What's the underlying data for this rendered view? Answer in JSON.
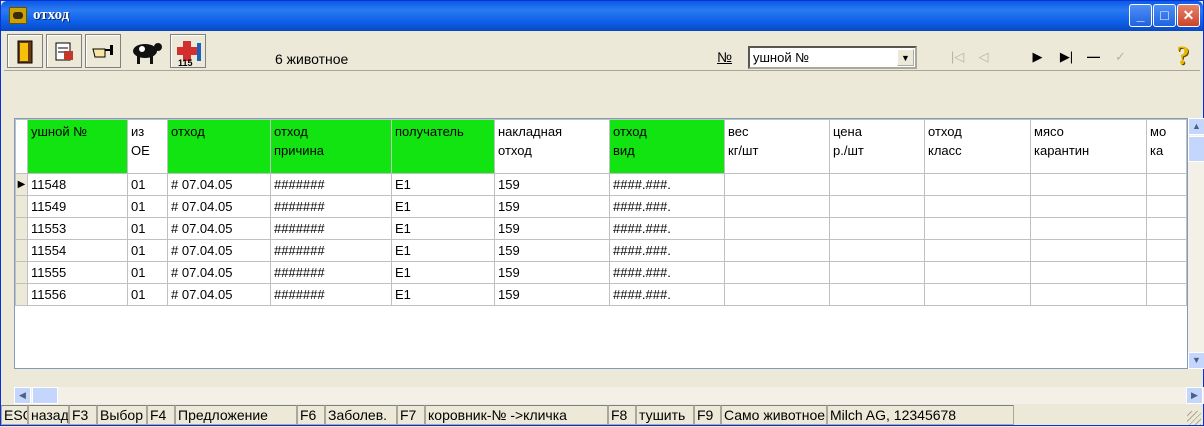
{
  "window": {
    "title": "отход"
  },
  "toolbar": {
    "record_label": "6  животное",
    "no_label": "№",
    "combo_value": "ушной №",
    "nav": {
      "first": "|◁",
      "prev": "◁",
      "next": "▶",
      "last": "▶|",
      "delete": "—",
      "post": "✓"
    },
    "help": "?"
  },
  "grid": {
    "columns": [
      {
        "l1": "ушной №",
        "l2": "",
        "green": true
      },
      {
        "l1": "из",
        "l2": "ОЕ",
        "green": false
      },
      {
        "l1": "отход",
        "l2": "",
        "green": true
      },
      {
        "l1": "отход",
        "l2": "причина",
        "green": true
      },
      {
        "l1": "получатель",
        "l2": "",
        "green": true
      },
      {
        "l1": "накладная",
        "l2": "отход",
        "green": false
      },
      {
        "l1": "отход",
        "l2": "вид",
        "green": true
      },
      {
        "l1": "вес",
        "l2": "кг/шт",
        "green": false
      },
      {
        "l1": "цена",
        "l2": "р./шт",
        "green": false
      },
      {
        "l1": "отход",
        "l2": "класс",
        "green": false
      },
      {
        "l1": "мясо",
        "l2": "карантин",
        "green": false
      },
      {
        "l1": "мо",
        "l2": "ка",
        "green": false
      }
    ],
    "rows": [
      [
        "11548",
        "01",
        "# 07.04.05",
        "#######",
        "E1",
        "159",
        "####.###.",
        "",
        "",
        "",
        "",
        ""
      ],
      [
        "11549",
        "01",
        "# 07.04.05",
        "#######",
        "E1",
        "159",
        "####.###.",
        "",
        "",
        "",
        "",
        ""
      ],
      [
        "11553",
        "01",
        "# 07.04.05",
        "#######",
        "E1",
        "159",
        "####.###.",
        "",
        "",
        "",
        "",
        ""
      ],
      [
        "11554",
        "01",
        "# 07.04.05",
        "#######",
        "E1",
        "159",
        "####.###.",
        "",
        "",
        "",
        "",
        ""
      ],
      [
        "11555",
        "01",
        "# 07.04.05",
        "#######",
        "E1",
        "159",
        "####.###.",
        "",
        "",
        "",
        "",
        ""
      ],
      [
        "11556",
        "01",
        "# 07.04.05",
        "#######",
        "E1",
        "159",
        "####.###.",
        "",
        "",
        "",
        "",
        ""
      ]
    ],
    "current_row": 0
  },
  "status": [
    "ESC",
    "назад",
    "F3",
    "Выбор",
    "F4",
    "Предложение",
    "F6",
    "Заболев.",
    "F7",
    "коровник-№ ->кличка",
    "F8",
    "тушить",
    "F9",
    "Само животное",
    "Milch AG, 12345678"
  ]
}
